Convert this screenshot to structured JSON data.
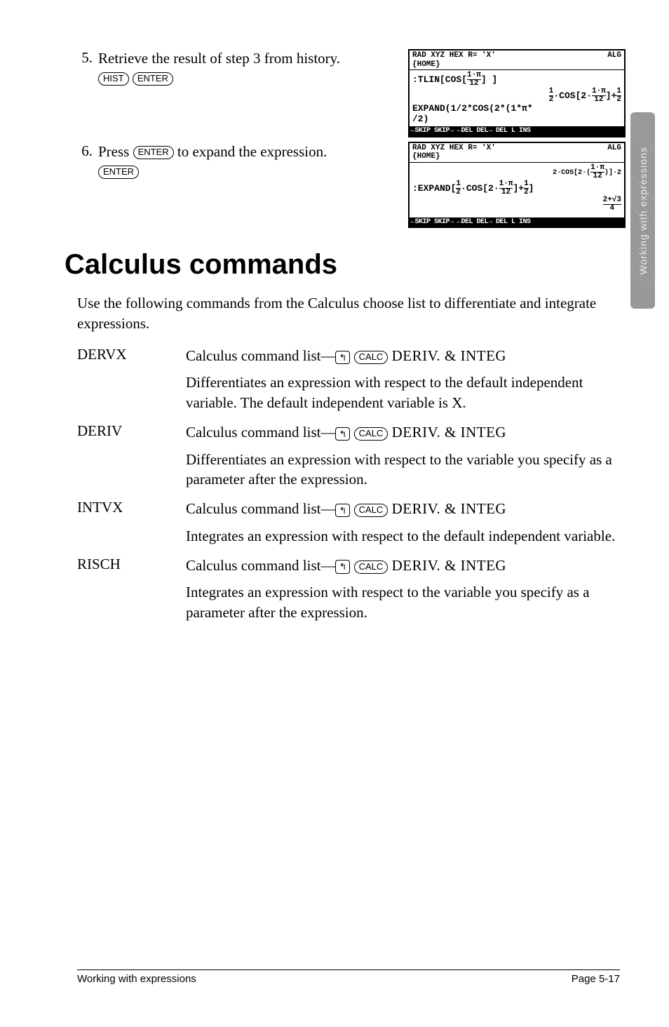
{
  "sidetab": "Working with expressions",
  "steps": [
    {
      "num": "5.",
      "text": "Retrieve the result of step 3 from history.",
      "keys": [
        "HIST",
        "ENTER"
      ]
    },
    {
      "num": "6.",
      "text_pre": "Press ",
      "key_mid": "ENTER",
      "text_post": " to expand the expression.",
      "keys": [
        "ENTER"
      ]
    }
  ],
  "screens": [
    {
      "hdr_left": "RAD XYZ HEX R= 'X'",
      "hdr_right": "ALG",
      "hdr_sub": "{HOME}",
      "line1": ":TLIN[COS[1·π/12] ]",
      "line2": "½·COS[2·1·π/12]+½",
      "line3": "EXPAND(1/2*COS(2*(1*π*",
      "line4": "/2)",
      "menu": "←SKIP SKIP→ ←DEL  DEL→ DEL L INS "
    },
    {
      "hdr_left": "RAD XYZ HEX R= 'X'",
      "hdr_right": "ALG",
      "hdr_sub": "{HOME}",
      "line1": "2·COS[2·(1·π/12)]·2",
      "line2": ":EXPAND[½·COS[2·1·π/12]+½]",
      "line3r": "2+√3",
      "line4r": "4",
      "menu": "←SKIP SKIP→ ←DEL  DEL→ DEL L INS "
    }
  ],
  "section_title": "Calculus commands",
  "intro": "Use the following commands from the Calculus choose list to differentiate and integrate expressions.",
  "commands": [
    {
      "name": "DERVX",
      "path_pre": "Calculus command list—",
      "path_key": "CALC",
      "path_post": " DERIV. & INTEG",
      "desc": "Differentiates an expression with respect to the default independent variable. The default independent variable is X."
    },
    {
      "name": "DERIV",
      "path_pre": "Calculus command list—",
      "path_key": "CALC",
      "path_post": " DERIV. & INTEG",
      "desc": "Differentiates an expression with respect to the variable you specify as a parameter after the expression."
    },
    {
      "name": "INTVX",
      "path_pre": "Calculus command list—",
      "path_key": "CALC",
      "path_post": " DERIV. & INTEG",
      "desc": "Integrates an expression with respect to the default independent variable."
    },
    {
      "name": "RISCH",
      "path_pre": "Calculus command list—",
      "path_key": "CALC",
      "path_post": " DERIV. & INTEG",
      "desc": "Integrates an expression with respect to the variable you specify as a parameter after the expression."
    }
  ],
  "footer_left": "Working with expressions",
  "footer_right": "Page 5-17"
}
